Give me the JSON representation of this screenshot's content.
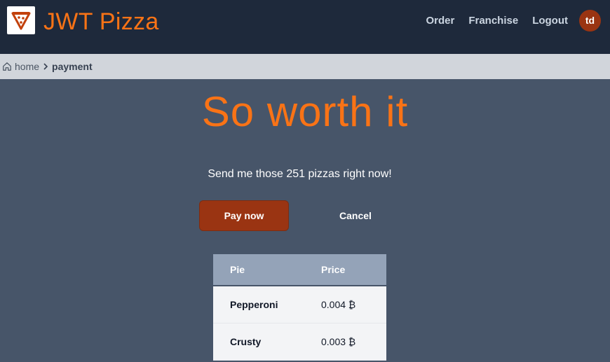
{
  "header": {
    "brand": "JWT Pizza",
    "nav": [
      "Order",
      "Franchise",
      "Logout"
    ],
    "avatar_initials": "td",
    "accent": "#f97316",
    "background": "#1e293b"
  },
  "breadcrumb": {
    "home": "home",
    "current": "payment"
  },
  "main": {
    "title": "So worth it",
    "message": "Send me those 251 pizzas right now!",
    "pay_label": "Pay now",
    "cancel_label": "Cancel"
  },
  "order_table": {
    "headers": [
      "Pie",
      "Price"
    ],
    "rows": [
      {
        "pie": "Pepperoni",
        "price": "0.004 ₿"
      },
      {
        "pie": "Crusty",
        "price": "0.003 ₿"
      }
    ]
  }
}
